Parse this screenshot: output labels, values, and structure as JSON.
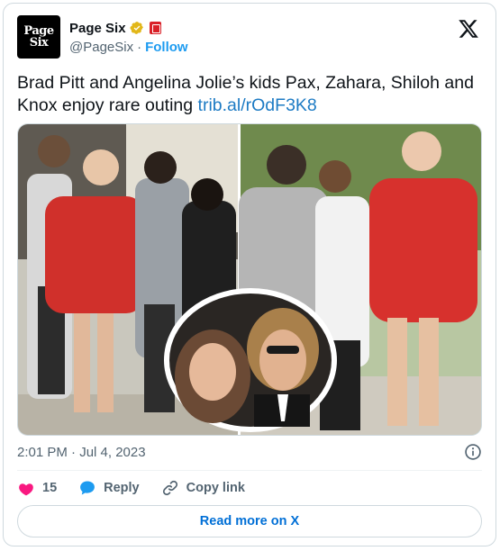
{
  "author": {
    "display_name": "Page Six",
    "handle": "@PageSix",
    "separator": "·",
    "follow_label": "Follow",
    "logo_line1": "Page",
    "logo_line2": "Six"
  },
  "tweet": {
    "text": "Brad Pitt and Angelina Jolie’s kids Pax, Zahara, Shiloh and Knox enjoy rare outing ",
    "link_text": "trib.al/rOdF3K8",
    "timestamp": "2:01 PM · Jul 4, 2023"
  },
  "actions": {
    "like_count": "15",
    "reply_label": "Reply",
    "copy_link_label": "Copy link"
  },
  "read_more_label": "Read more on X",
  "icons": {
    "verified": "verified-badge-icon",
    "flag": "flag-badge-icon",
    "x_logo": "x-logo-icon",
    "info": "info-icon",
    "heart": "heart-icon",
    "reply": "reply-bubble-icon",
    "link": "link-icon"
  },
  "colors": {
    "accent": "#1d9bf0",
    "heart": "#f91880",
    "verified": "#e2b719",
    "link": "#1d7bc4"
  }
}
